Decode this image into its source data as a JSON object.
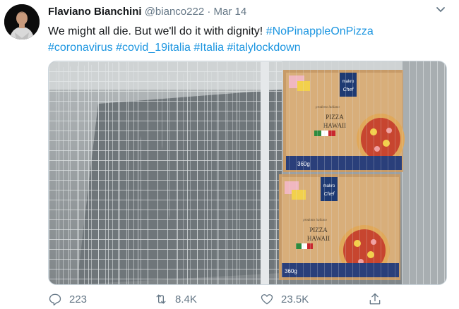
{
  "user": {
    "name": "Flaviano Bianchini",
    "handle": "@bianco222",
    "separator": "·",
    "date": "Mar 14"
  },
  "tweet": {
    "text": "We might all die. But we'll do it with dignity!",
    "hashtags": [
      "#NoPinappleOnPizza",
      "#coronavirus",
      "#covid_19italia",
      "#Italia",
      "#italylockdown"
    ]
  },
  "media": {
    "box_brand": "makro",
    "box_sub": "Chef",
    "box_script": "prodotto italiano",
    "box_title_1": "PIZZA",
    "box_title_2": "HAWAII",
    "box_weight": "360g"
  },
  "actions": {
    "replies": "223",
    "retweets": "8.4K",
    "likes": "23.5K"
  },
  "icons": [
    "more-chevron-icon",
    "reply-icon",
    "retweet-icon",
    "like-icon",
    "share-icon"
  ],
  "colors": {
    "link": "#1b95e0",
    "muted": "#657786",
    "text": "#14171a"
  }
}
